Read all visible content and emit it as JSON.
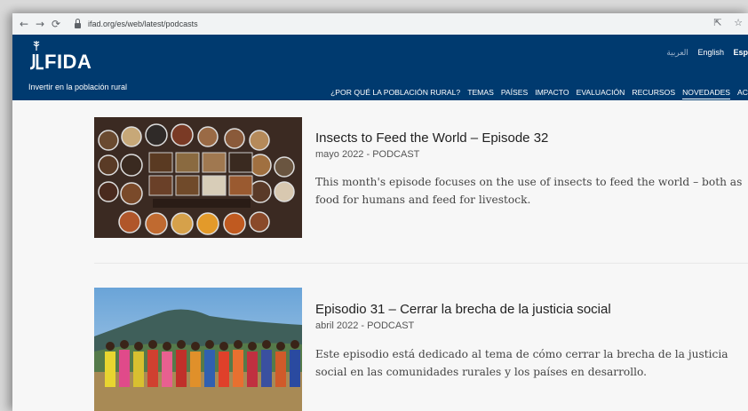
{
  "browser": {
    "url": "ifad.org/es/web/latest/podcasts",
    "icons": [
      "back-icon",
      "forward-icon",
      "reload-icon",
      "lock-icon",
      "share-icon",
      "star-icon"
    ]
  },
  "header": {
    "logo_text": "FIDA",
    "tagline": "Invertir en la población rural",
    "languages": [
      "العربية",
      "English",
      "Esp"
    ],
    "menu": [
      "¿POR QUÉ LA POBLACIÓN RURAL?",
      "TEMAS",
      "PAÍSES",
      "IMPACTO",
      "EVALUACIÓN",
      "RECURSOS",
      "NOVEDADES",
      "AC"
    ],
    "active_menu": "NOVEDADES"
  },
  "articles": [
    {
      "title": "Insects to Feed the World – Episode 32",
      "meta": "mayo 2022 - PODCAST",
      "desc": "This month's episode focuses on the use of insects to feed the world – both as food for humans and feed for livestock."
    },
    {
      "title": "Episodio 31 – Cerrar la brecha de la justicia social",
      "meta": "abril 2022 - PODCAST",
      "desc": "Este episodio está dedicado al tema de cómo cerrar la brecha de la justicia social en las comunidades rurales y los países en desarrollo."
    }
  ],
  "colors": {
    "header_bg": "#003a6f",
    "page_bg": "#f7f7f7"
  }
}
